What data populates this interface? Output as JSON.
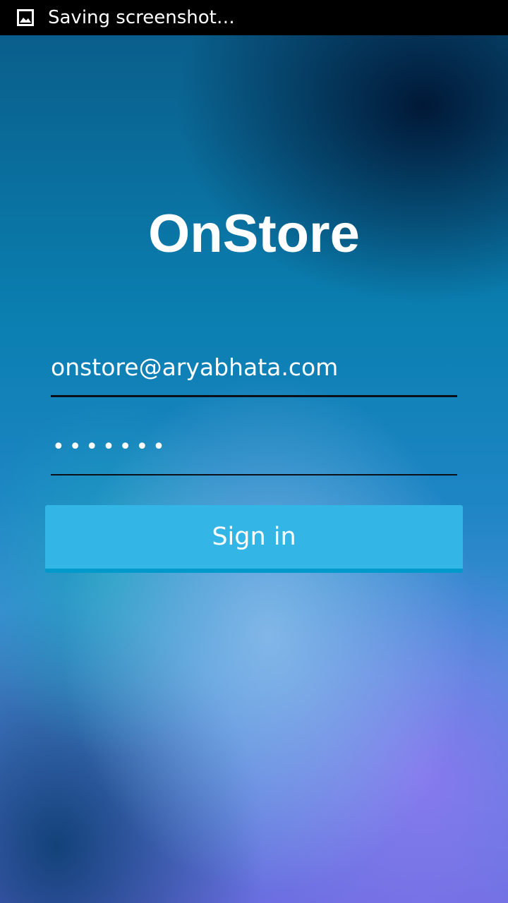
{
  "status_bar": {
    "icon": "image-icon",
    "notification_text": "Saving screenshot…"
  },
  "app": {
    "title": "OnStore"
  },
  "login_form": {
    "email_value": "onstore@aryabhata.com",
    "password_masked": "•••••••",
    "sign_in_label": "Sign in"
  },
  "colors": {
    "button_background": "#33b5e5",
    "button_shadow": "#0099cc",
    "status_bar_background": "#000000",
    "text": "#ffffff"
  }
}
